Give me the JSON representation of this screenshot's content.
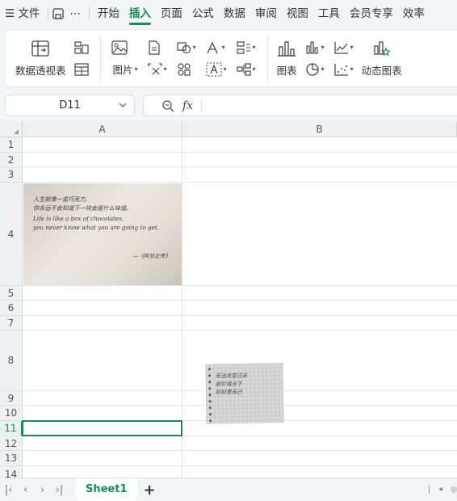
{
  "menu": {
    "file_label": "文件",
    "tabs": [
      "开始",
      "插入",
      "页面",
      "公式",
      "数据",
      "审阅",
      "视图",
      "工具",
      "会员专享",
      "效率"
    ],
    "active_tab": "插入"
  },
  "ribbon": {
    "pivot_table": "数据透视表",
    "picture": "图片",
    "chart": "图表",
    "dynamic_chart": "动态图表"
  },
  "formula": {
    "cell_ref": "D11",
    "fx_label": "fx",
    "value": ""
  },
  "columns": [
    "A",
    "B"
  ],
  "rows": [
    "1",
    "2",
    "3",
    "4",
    "5",
    "6",
    "7",
    "8",
    "9",
    "10",
    "11",
    "12",
    "13",
    "14"
  ],
  "selected_row": "11",
  "image1": {
    "line1": "人生就像一盒巧克力,",
    "line2": "你永远不会知道下一块会是什么味道。",
    "line3": "Life is like a box of chocolates,",
    "line4": "you never know what you are going to get.",
    "signature": "—《阿甘正传》"
  },
  "image2": {
    "line1": "无法改变过去",
    "line2": "就珍惜当下",
    "line3": "好好爱自己"
  },
  "sheets": {
    "tabs": [
      "Sheet1"
    ],
    "active": "Sheet1",
    "add_label": "+"
  },
  "colors": {
    "accent": "#1a8a5a"
  }
}
